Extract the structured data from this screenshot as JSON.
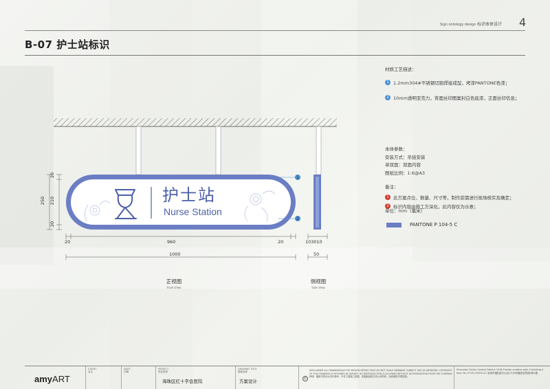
{
  "header": {
    "subtitle_en": "Sign ontology design",
    "subtitle_cn": "标识本体设计",
    "page_number": "4",
    "title": "B-07 护士站标识"
  },
  "sign": {
    "text_cn": "护士站",
    "text_en": "Nurse Station"
  },
  "dimensions": {
    "width_parts": [
      "20",
      "960",
      "20"
    ],
    "total_width": "1000",
    "height_total": "250",
    "height_parts": [
      "20",
      "210",
      "20"
    ],
    "side_parts": "103010",
    "side_total": "50"
  },
  "callouts": [
    "1",
    "2"
  ],
  "views": {
    "front_cn": "正视图",
    "front_en": "Front View",
    "side_cn": "侧视图",
    "side_en": "Side View"
  },
  "materials": {
    "heading": "材质工艺描述：",
    "items": [
      {
        "num": "1",
        "text": "1.2mm304#不锈钢切割焊接成型，烤漆PANTONE色漆；"
      },
      {
        "num": "2",
        "text": "10mm透明亚克力，背面丝印图案封白色底漆，正面丝印信息；"
      }
    ]
  },
  "params": {
    "heading": "本体参数：",
    "install": "安装方式：吊挂安装",
    "faces": "单双面：双面内容",
    "scale": "图纸比例：1:6@A3"
  },
  "remarks": {
    "heading": "备注：",
    "items": [
      {
        "num": "1",
        "text": "此方案点位、数量、尺寸等，制作前需进行现场核实及确定；"
      },
      {
        "num": "2",
        "text": "标识内容由施工方深化，此内容仅为示意；"
      }
    ],
    "unit": "单位：mm（毫米）"
  },
  "color_swatch": {
    "label": "PANTONE P 104-5 C",
    "hex": "#6b7ec4"
  },
  "footer": {
    "logo_bold": "amy",
    "logo_rest": "ART",
    "client_label": "CLIENT",
    "client_sub": "业主",
    "date_label": "DATE",
    "date_sub": "日期",
    "project_label": "PROJECT",
    "project_sub": "项目名称",
    "project_value": "海珠区红十字会医院",
    "drawing_label": "DRAWING TITLE",
    "drawing_sub": "图纸名称",
    "drawing_value": "方案设计",
    "disclaimer": "DISCLAIMER ALL DRAWINGS/AS FOR DESIGN INTENT ONLY. DO NOT SCALE DRAWING. SUBJECT USE AS ARTWORK. COPYRIGHT OF THIS DRAWING IS RETAINED BY AMYART. NO REPRODUCTION IS ALLOWED WITHOUT AUTHORIZATION FROM THE COMPANY. 声明：图纸中的设计仅作参考，不作工程施工依据。本图纸版权归本公司所有，未经授权不得复制。",
    "contact": "Shenzhen Futian Central District 1518 Fuzhan creative park 4 building 4 floor Tel: 0755-23553112 深圳市福田区中心区1518号福田创意园4栋4楼"
  },
  "colors": {
    "accent": "#6b7ec4",
    "sign_border": "#6b7ec4"
  }
}
